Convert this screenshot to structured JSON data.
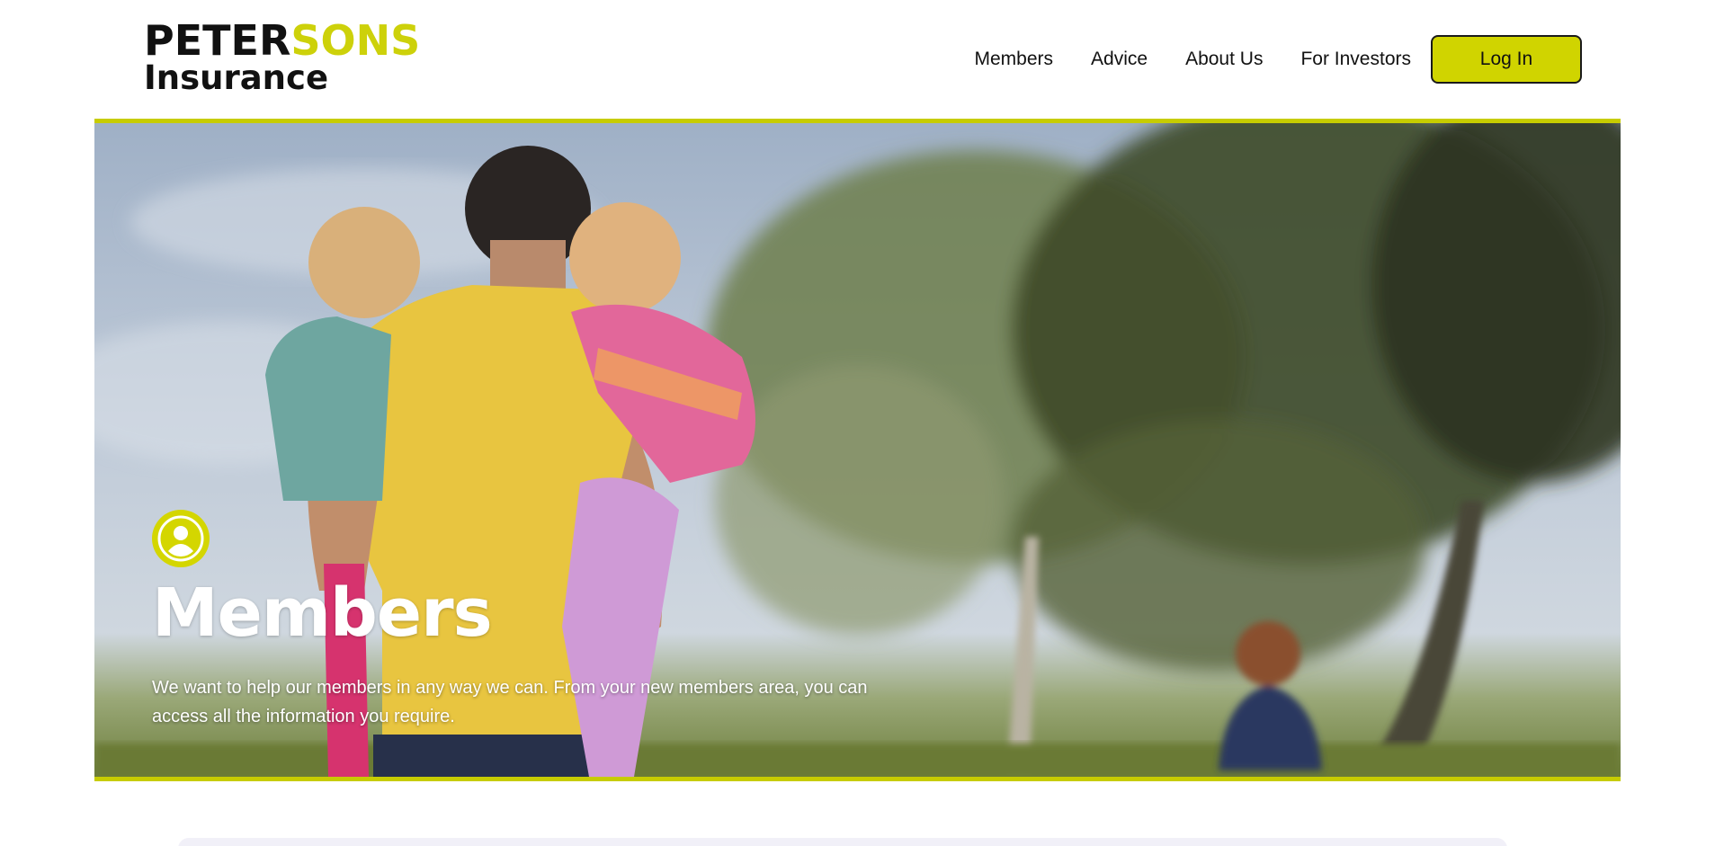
{
  "brand": {
    "name_part1": "PETER",
    "name_part2": "SONS",
    "name_line2": "Insurance",
    "accent_color": "#cdd10a"
  },
  "nav": {
    "items": [
      {
        "label": "Members"
      },
      {
        "label": "Advice"
      },
      {
        "label": "About Us"
      },
      {
        "label": "For Investors"
      }
    ],
    "login_label": "Log In",
    "login_color": "#d0d400"
  },
  "hero": {
    "icon": "user-circle-icon",
    "title": "Members",
    "description": "We want to help our members in any way we can. From your new members area, you can access all the information you require.",
    "border_color": "#c7cc00"
  }
}
